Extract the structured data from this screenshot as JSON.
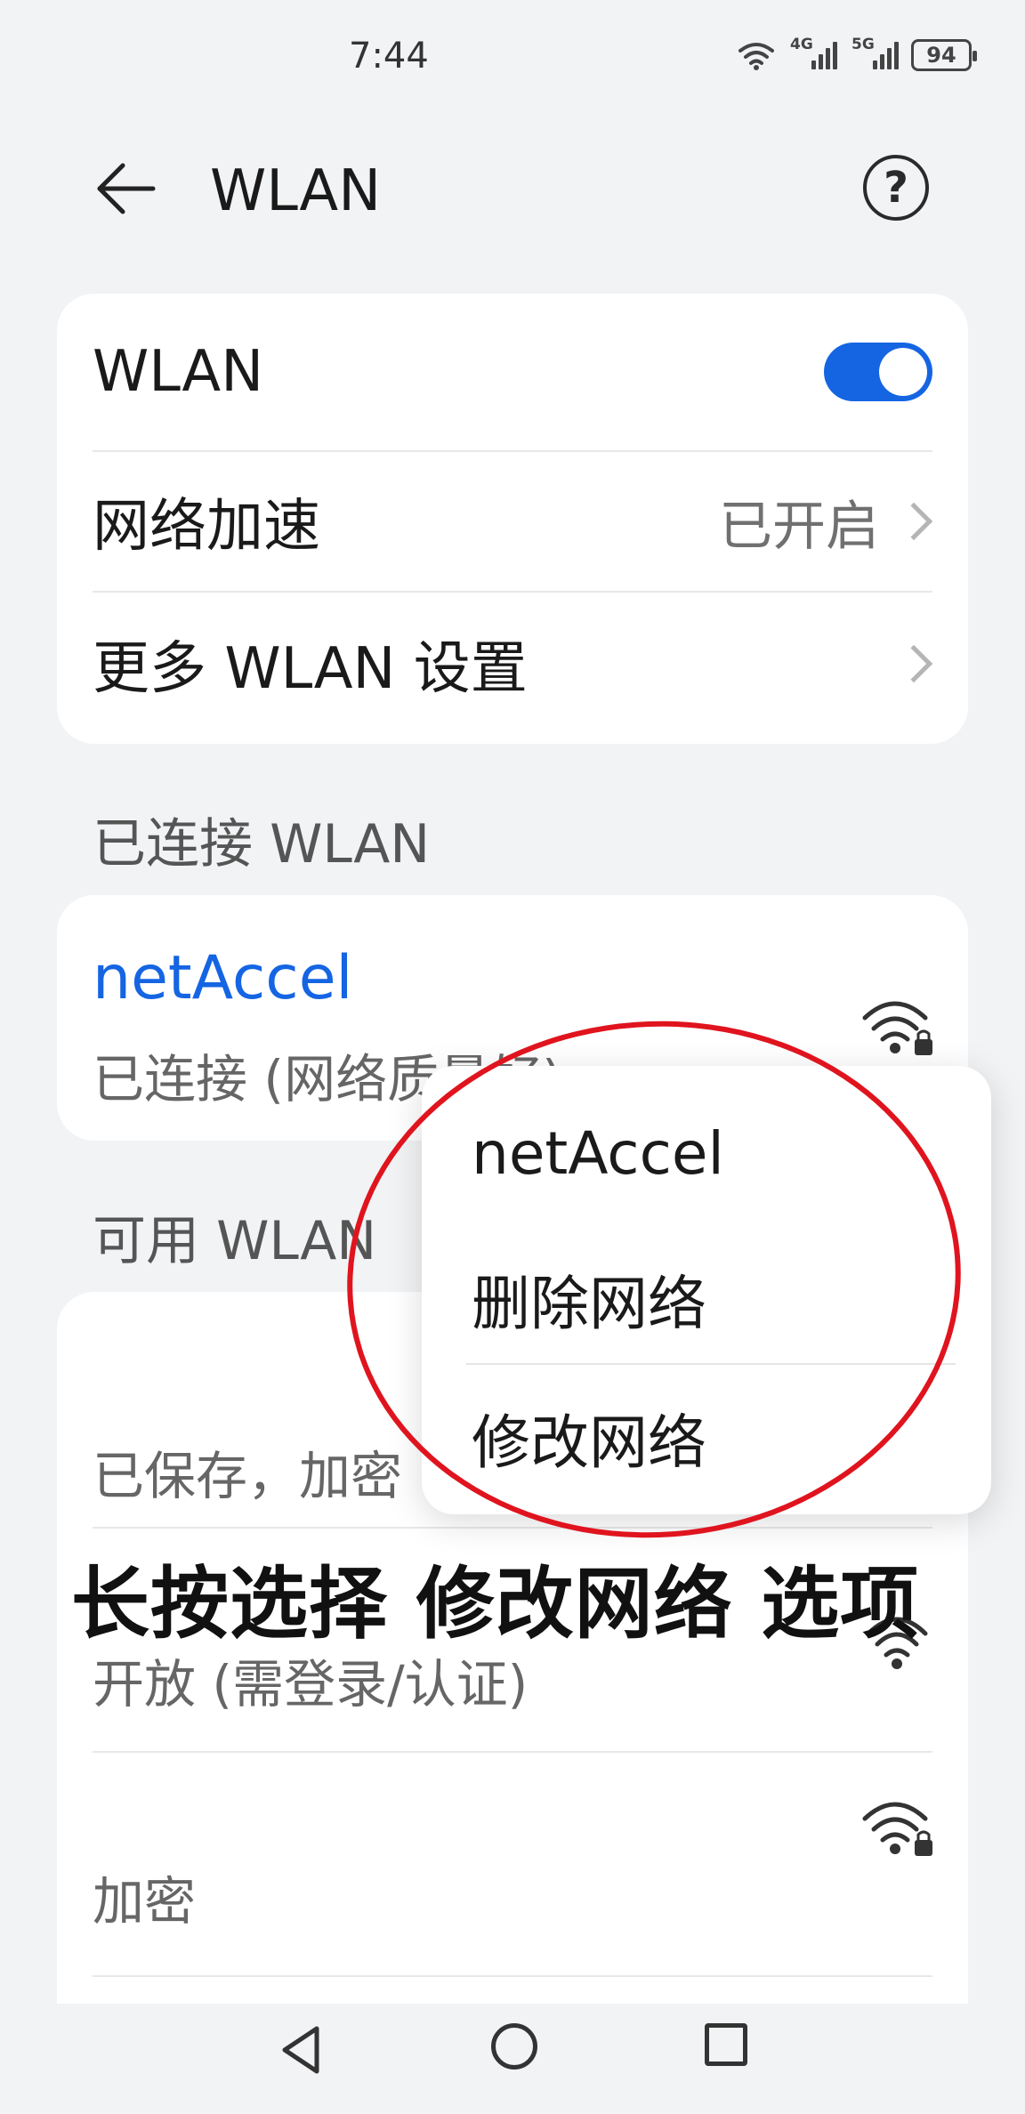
{
  "status_bar": {
    "time": "7:44",
    "signal_1_tag": "4G",
    "signal_2_tag": "5G",
    "battery": "94"
  },
  "header": {
    "title": "WLAN",
    "back_icon": "arrow-left-icon",
    "help_icon": "question-circle-icon",
    "help_glyph": "?"
  },
  "settings_card": {
    "wlan_label": "WLAN",
    "wlan_enabled": true,
    "network_accel_label": "网络加速",
    "network_accel_value": "已开启",
    "more_settings_label": "更多 WLAN 设置"
  },
  "connected_section": {
    "title": "已连接 WLAN",
    "network_name": "netAccel",
    "network_status": "已连接 (网络质量好)"
  },
  "available_section": {
    "title": "可用 WLAN",
    "items": [
      {
        "name": "",
        "status": "已保存，加密"
      },
      {
        "name": "",
        "status": "开放 (需登录/认证)"
      },
      {
        "name": "",
        "status": "加密"
      }
    ]
  },
  "context_menu": {
    "title": "netAccel",
    "delete_label": "删除网络",
    "modify_label": "修改网络"
  },
  "annotation": "长按选择 修改网络 选项",
  "colors": {
    "accent": "#1565e3",
    "annotation_circle": "#e0141e",
    "background": "#f1f3f5"
  }
}
